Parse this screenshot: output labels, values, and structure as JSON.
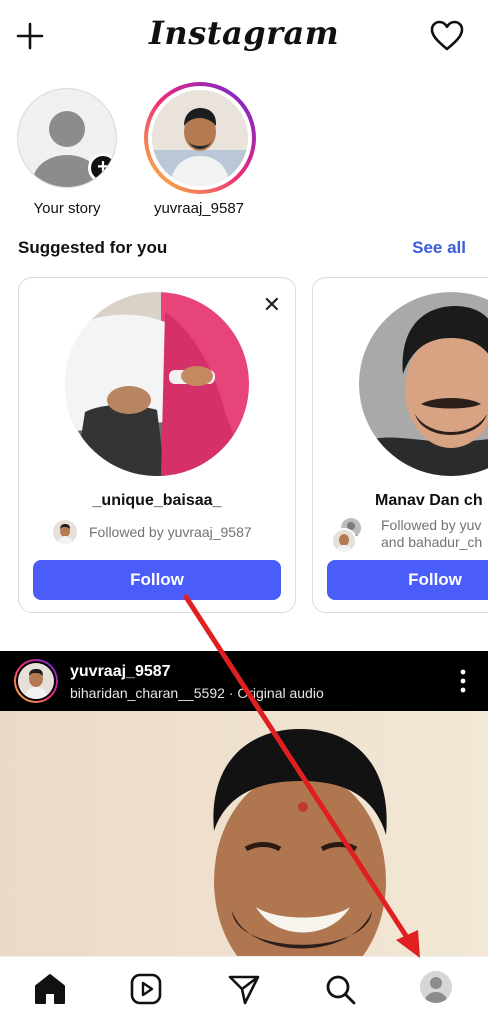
{
  "app": {
    "logo_text": "Instagram"
  },
  "stories": [
    {
      "label": "Your story"
    },
    {
      "label": "yuvraaj_9587"
    }
  ],
  "suggested": {
    "title": "Suggested for you",
    "see_all": "See all",
    "cards": [
      {
        "name": "_unique_baisaa_",
        "followed_by": "Followed by yuvraaj_9587",
        "follow_label": "Follow"
      },
      {
        "name": "Manav Dan ch",
        "followed_by_line1": "Followed by yuv",
        "followed_by_line2": "and bahadur_ch",
        "follow_label": "Follow"
      }
    ]
  },
  "post": {
    "username": "yuvraaj_9587",
    "subtitle": "biharidan_charan__5592 · Original audio"
  },
  "nav": {
    "items": [
      "home-icon",
      "reels-icon",
      "direct-icon",
      "search-icon",
      "profile-avatar"
    ]
  },
  "colors": {
    "accent": "#4a5df9",
    "link": "#3b5bdb",
    "annotation_arrow": "#e02020"
  }
}
